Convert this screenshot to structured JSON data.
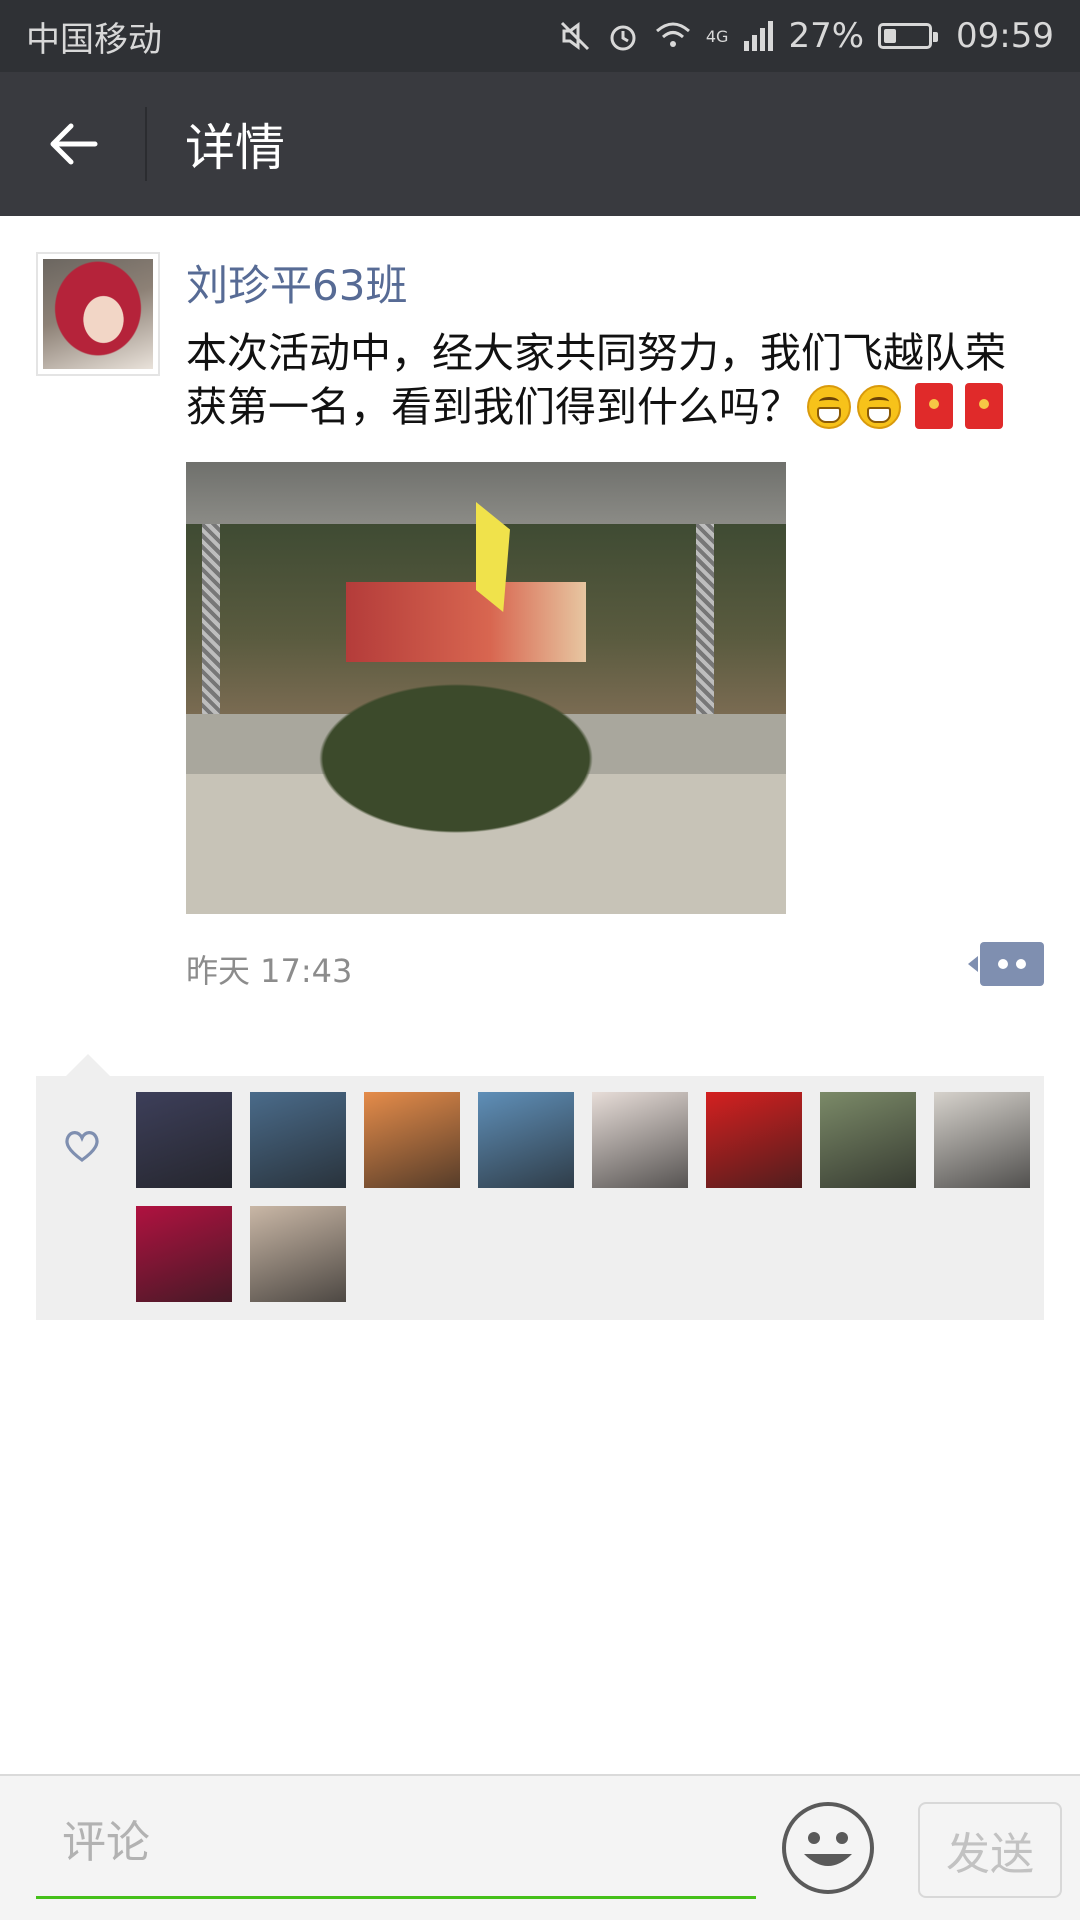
{
  "status_bar": {
    "carrier": "中国移动",
    "network": "4G",
    "battery": "27%",
    "battery_level": 0.27,
    "time": "09:59",
    "icons": [
      "mute-icon",
      "alarm-icon",
      "wifi-icon",
      "signal-icon",
      "battery-icon"
    ]
  },
  "title_bar": {
    "back_icon": "arrow-left-icon",
    "title": "详情"
  },
  "post": {
    "author": "刘珍平63班",
    "text": "本次活动中，经大家共同努力，我们飞越队荣获第一名，看到我们得到什么吗？",
    "emojis": [
      "grin-icon",
      "grin-icon",
      "red-packet-icon",
      "red-packet-icon"
    ],
    "time": "昨天 17:43",
    "more_icon": "comment-dots-icon"
  },
  "likes": {
    "icon": "heart-icon",
    "avatars": [
      {
        "name": "liker-1",
        "color": "#3d3f5a"
      },
      {
        "name": "liker-2",
        "color": "#4a6b8a"
      },
      {
        "name": "liker-3",
        "color": "#e58c4a"
      },
      {
        "name": "liker-4",
        "color": "#5f8fb8"
      },
      {
        "name": "liker-5",
        "color": "#e7ddd8"
      },
      {
        "name": "liker-6",
        "color": "#d42020"
      },
      {
        "name": "liker-7",
        "color": "#7b8a68"
      },
      {
        "name": "liker-8",
        "color": "#d6d2cc"
      },
      {
        "name": "liker-9",
        "color": "#b01240"
      },
      {
        "name": "liker-10",
        "color": "#c9b7a6"
      }
    ]
  },
  "bottom_bar": {
    "comment_placeholder": "评论",
    "emoji_icon": "smiley-icon",
    "send_label": "发送",
    "accent_color": "#45c01a"
  }
}
